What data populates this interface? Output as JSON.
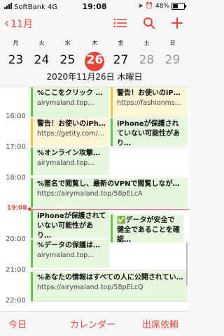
{
  "status": {
    "carrier": "SoftBank",
    "network": "4G",
    "time": "19:08",
    "battery_percent": "48%",
    "battery_level": 0.48
  },
  "nav": {
    "back_label": "11月",
    "icons": [
      "list-icon",
      "search-icon",
      "add-icon"
    ]
  },
  "week": {
    "weekdays": [
      "月",
      "火",
      "水",
      "木",
      "金",
      "土",
      "日"
    ],
    "dates": [
      "23",
      "24",
      "25",
      "26",
      "27",
      "28",
      "29"
    ],
    "selected": "26",
    "full_date": "2020年11月26日 木曜日"
  },
  "hours": [
    "16:00",
    "17:00",
    "18:00",
    "20:00",
    "21:00",
    "22:00"
  ],
  "now_label": "19:08",
  "events": [
    {
      "title": "%ここをクリック し…",
      "url": "airymaland.top…",
      "color": "green"
    },
    {
      "title": "警告！お使いのiPho…",
      "url": "https://fashionmsg.co…",
      "color": "yellow"
    },
    {
      "title": "警告！お使いのiPho…",
      "url": "https://getity.com/clic…",
      "color": "yellow"
    },
    {
      "title": "iPhoneが保護されていない可能性があり…",
      "color": "green"
    },
    {
      "title": "%オンライン攻撃に…",
      "url": "airymaland.top…",
      "color": "green"
    },
    {
      "title": "%匿名で閲覧し、最新のVPNで閲覧しながら…",
      "url": "https://airymaland.top/58pELcA",
      "color": "green"
    },
    {
      "title": "iPhoneが保護されていない可能性があり…",
      "color": "green"
    },
    {
      "title": "✅データが安全で健全であることを確認…",
      "color": "green"
    },
    {
      "title": "%データの保護は貴…",
      "url": "airymaland.top…",
      "color": "green"
    },
    {
      "title": "%あなたの情報はすべての人に公開されていま…",
      "url": "https://airymaland.top/58pELcQ",
      "color": "green"
    }
  ],
  "tabbar": {
    "today": "今日",
    "calendars": "カレンダー",
    "inbox": "出席依頼"
  },
  "colors": {
    "accent": "#e5463b",
    "green_event": "#e4f6dc",
    "yellow_event": "#fdf6d7"
  }
}
